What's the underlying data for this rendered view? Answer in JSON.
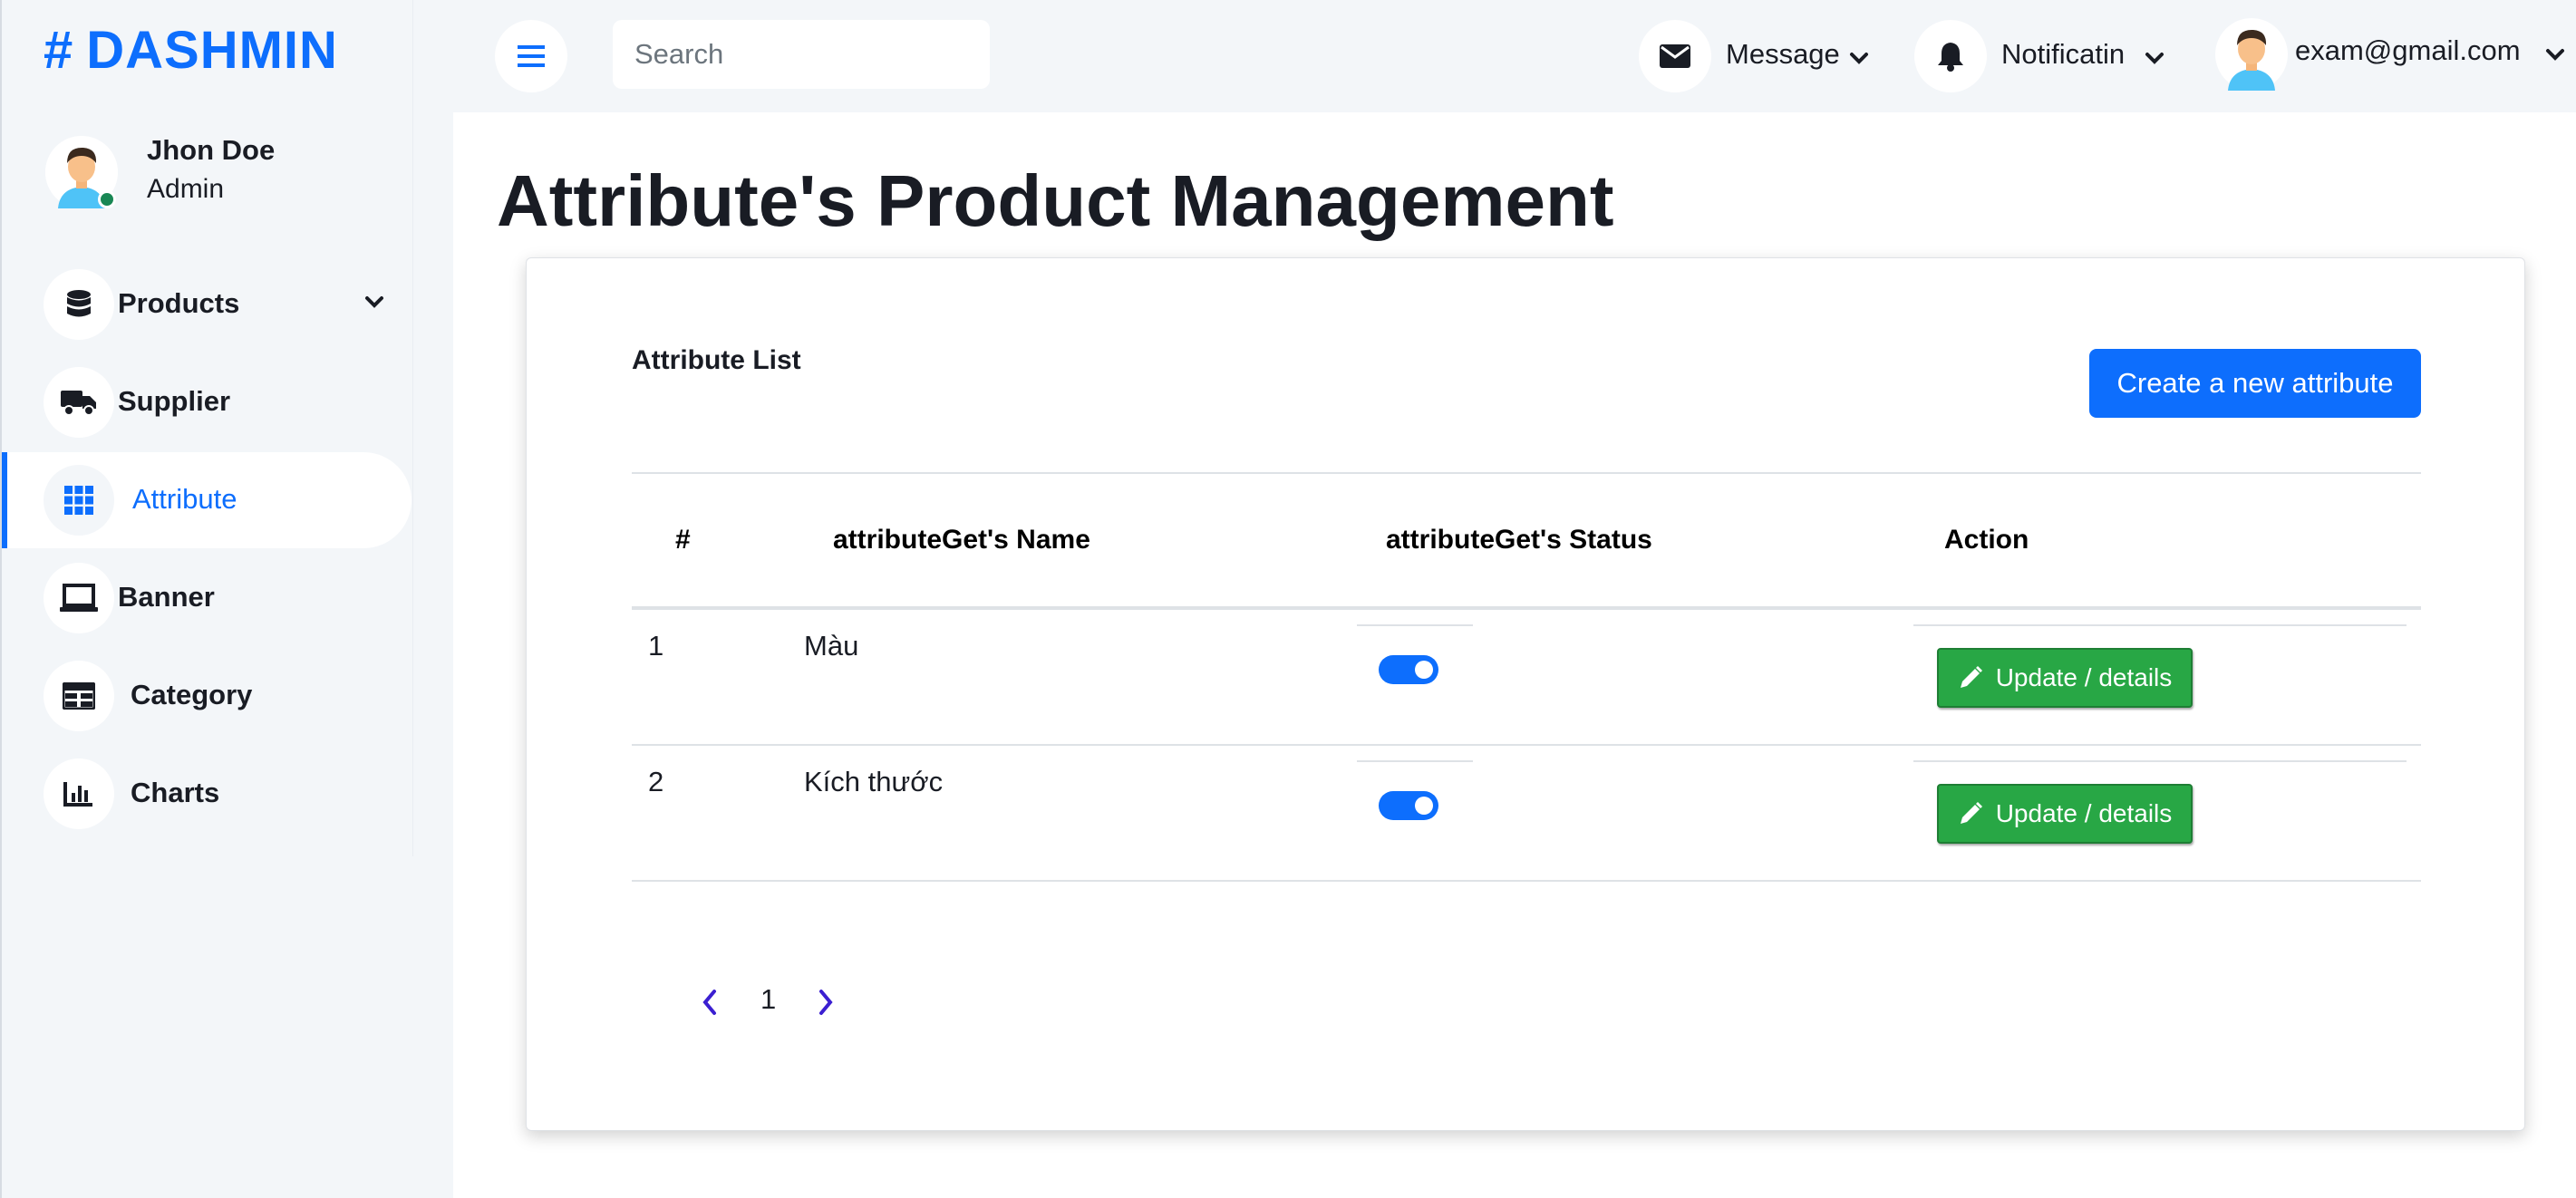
{
  "brand": {
    "hash": "#",
    "name": "DASHMIN"
  },
  "profile": {
    "name": "Jhon Doe",
    "role": "Admin"
  },
  "sidebar": {
    "items": [
      {
        "label": "Products",
        "icon": "database-icon"
      },
      {
        "label": "Supplier",
        "icon": "truck-icon"
      },
      {
        "label": "Attribute",
        "icon": "grid-icon"
      },
      {
        "label": "Banner",
        "icon": "laptop-icon"
      },
      {
        "label": "Category",
        "icon": "table-icon"
      },
      {
        "label": "Charts",
        "icon": "chart-bar-icon"
      }
    ]
  },
  "topbar": {
    "search_placeholder": "Search",
    "message_label": "Message",
    "notification_label": "Notificatin",
    "user_email": "exam@gmail.com"
  },
  "main": {
    "page_title": "Attribute's Product Management",
    "card_title": "Attribute List",
    "create_button": "Create a new attribute",
    "table": {
      "headers": [
        "#",
        "attributeGet's Name",
        "attributeGet's Status",
        "Action"
      ],
      "rows": [
        {
          "index": "1",
          "name": "Màu",
          "status_on": true,
          "action": "Update / details"
        },
        {
          "index": "2",
          "name": "Kích thước",
          "status_on": true,
          "action": "Update / details"
        }
      ]
    },
    "pagination": {
      "current_page": "1"
    }
  },
  "colors": {
    "primary": "#0d6efd",
    "success": "#28a745",
    "sidebar_bg": "#f3f6f9",
    "text": "#191c24"
  }
}
